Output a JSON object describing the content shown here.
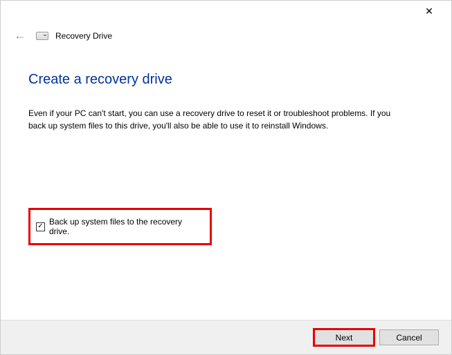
{
  "titlebar": {
    "close_glyph": "✕"
  },
  "header": {
    "back_glyph": "←",
    "title": "Recovery Drive"
  },
  "main": {
    "heading": "Create a recovery drive",
    "description": "Even if your PC can't start, you can use a recovery drive to reset it or troubleshoot problems. If you back up system files to this drive, you'll also be able to use it to reinstall Windows."
  },
  "checkbox": {
    "checked_glyph": "✓",
    "label": "Back up system files to the recovery drive."
  },
  "footer": {
    "next_label": "Next",
    "cancel_label": "Cancel"
  }
}
